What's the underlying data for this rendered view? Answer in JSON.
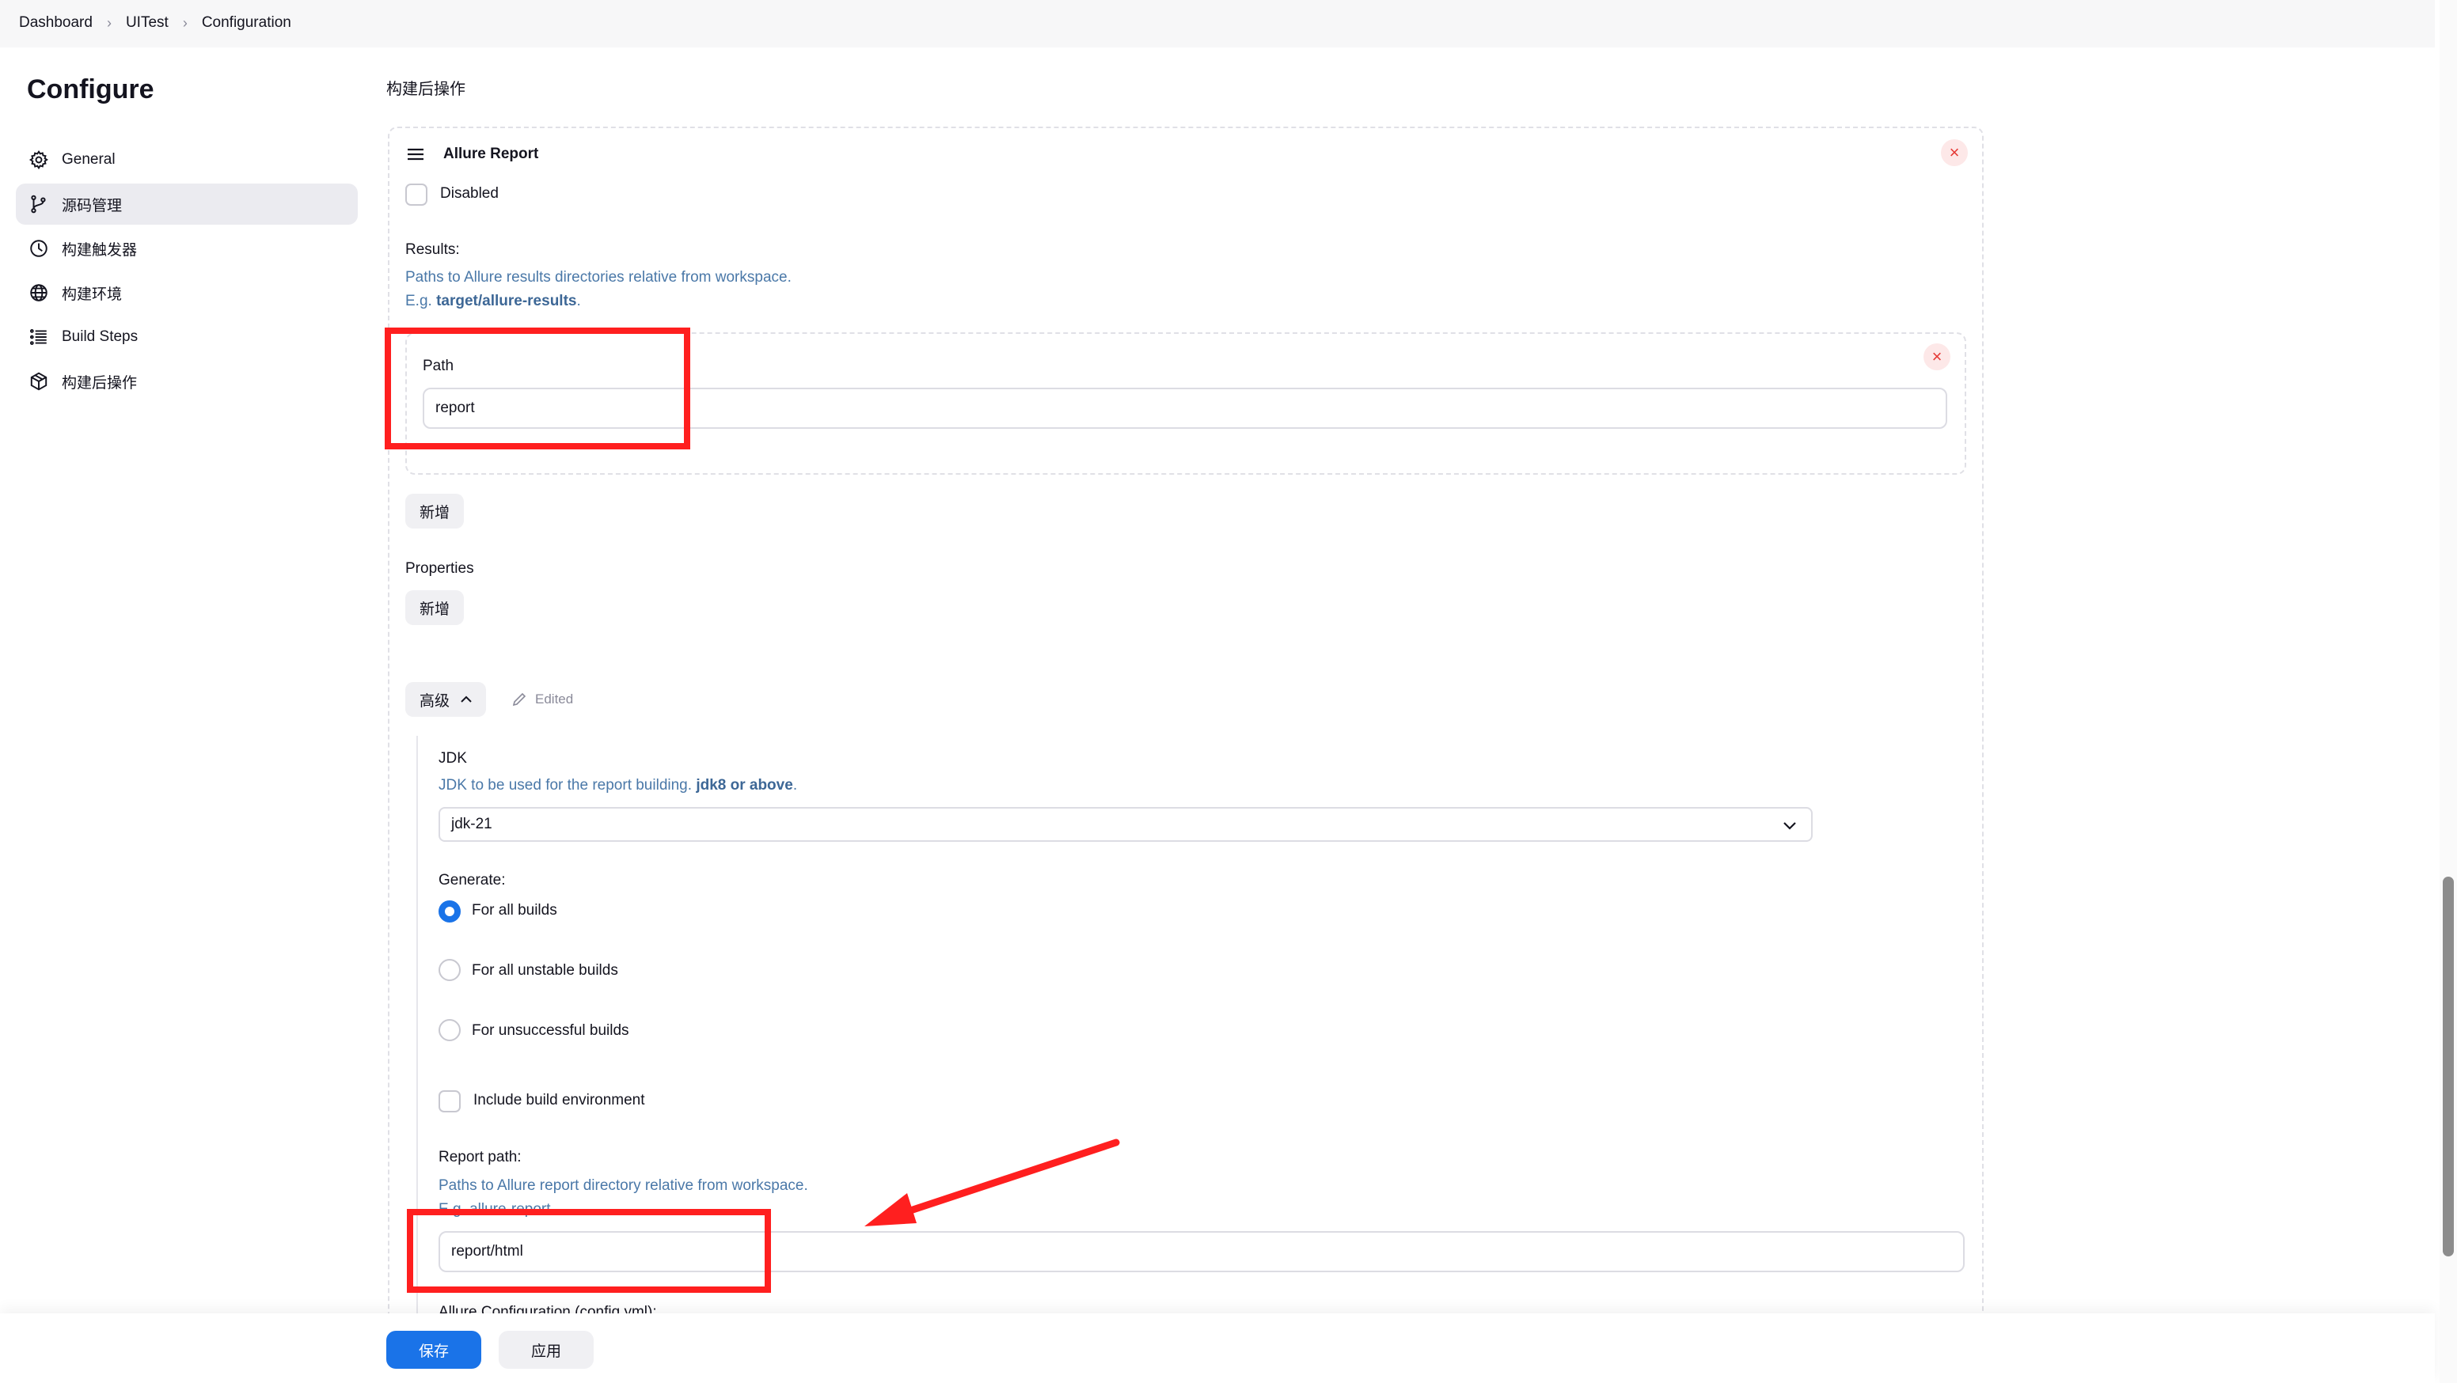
{
  "breadcrumb": [
    "Dashboard",
    "UITest",
    "Configuration"
  ],
  "sidebar": {
    "title": "Configure",
    "items": [
      {
        "label": "General",
        "icon": "gear-icon"
      },
      {
        "label": "源码管理",
        "icon": "branch-icon"
      },
      {
        "label": "构建触发器",
        "icon": "clock-icon"
      },
      {
        "label": "构建环境",
        "icon": "globe-icon"
      },
      {
        "label": "Build Steps",
        "icon": "list-icon"
      },
      {
        "label": "构建后操作",
        "icon": "package-icon"
      }
    ]
  },
  "main": {
    "section_title": "构建后操作",
    "allure": {
      "title": "Allure Report",
      "disabled_label": "Disabled",
      "results_label": "Results:",
      "results_help": "Paths to Allure results directories relative from workspace.",
      "results_example_prefix": "E.g. ",
      "results_example": "target/allure-results",
      "results_example_suffix": ".",
      "path_label": "Path",
      "path_value": "report",
      "add_label": "新增",
      "properties_label": "Properties",
      "properties_add_label": "新增",
      "advanced_label": "高级",
      "edited_label": "Edited",
      "jdk_label": "JDK",
      "jdk_help": "JDK to be used for the report building. ",
      "jdk_help_bold": "jdk8 or above",
      "jdk_help_suffix": ".",
      "jdk_value": "jdk-21",
      "generate_label": "Generate:",
      "generate_options": [
        "For all builds",
        "For all unstable builds",
        "For unsuccessful builds"
      ],
      "generate_selected": 0,
      "include_env_label": "Include build environment",
      "report_path_label": "Report path:",
      "report_path_help": "Paths to Allure report directory relative from workspace.",
      "report_path_example": "E.g. allure-report",
      "report_path_value": "report/html",
      "config_label": "Allure Configuration (config.yml):"
    }
  },
  "footer": {
    "save_label": "保存",
    "apply_label": "应用"
  },
  "colors": {
    "accent": "#1a73e8",
    "annotation": "#ff1f1f",
    "help_text": "#4a78a8"
  }
}
